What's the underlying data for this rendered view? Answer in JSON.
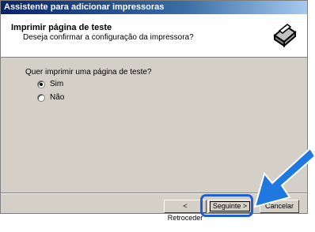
{
  "window": {
    "title": "Assistente para adicionar impressoras"
  },
  "header": {
    "title": "Imprimir página de teste",
    "subtitle": "Deseja confirmar a configuração da impressora?"
  },
  "main": {
    "question": "Quer imprimir uma página de teste?",
    "options": [
      {
        "label": "Sim",
        "selected": true
      },
      {
        "label": "Não",
        "selected": false
      }
    ]
  },
  "buttons": {
    "back_label": "< Retroceder",
    "next_label": "Seguinte >",
    "cancel_label": "Cancelar"
  },
  "colors": {
    "title_bar": "#0a246a",
    "highlight": "#1e5ed6",
    "arrow": "#1f78e0"
  }
}
